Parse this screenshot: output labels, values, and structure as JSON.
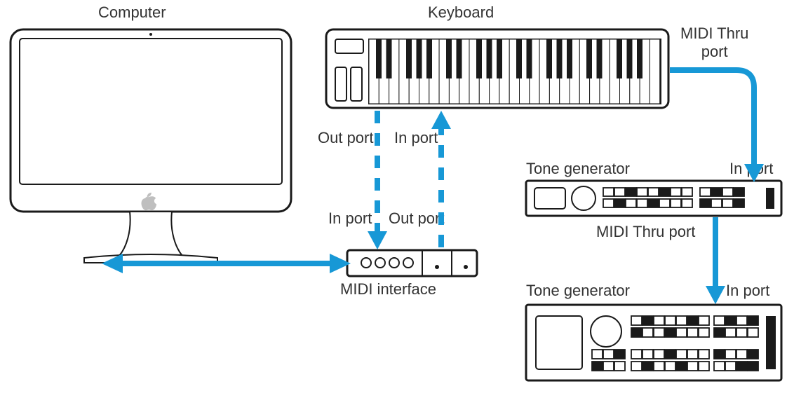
{
  "labels": {
    "computer": "Computer",
    "keyboard": "Keyboard",
    "midi_interface": "MIDI interface",
    "tone_generator_1": "Tone generator",
    "tone_generator_2": "Tone generator",
    "out_port_top": "Out port",
    "in_port_top": "In port",
    "in_port_bottom": "In port",
    "out_port_bottom": "Out port",
    "midi_thru_port_kbd": "MIDI Thru\nport",
    "in_port_tg1": "In port",
    "midi_thru_port_tg1": "MIDI Thru port",
    "in_port_tg2": "In port"
  },
  "colors": {
    "cable": "#1798d6",
    "outline": "#1a1a1a"
  },
  "diagram": {
    "description": "MIDI signal flow diagram showing a Computer connected bidirectionally to a MIDI interface; the MIDI interface In port receives from the Keyboard Out port and the MIDI interface Out port sends to the Keyboard In port; the Keyboard MIDI Thru port feeds the first Tone generator's In port; that Tone generator's MIDI Thru port feeds the second Tone generator's In port."
  }
}
